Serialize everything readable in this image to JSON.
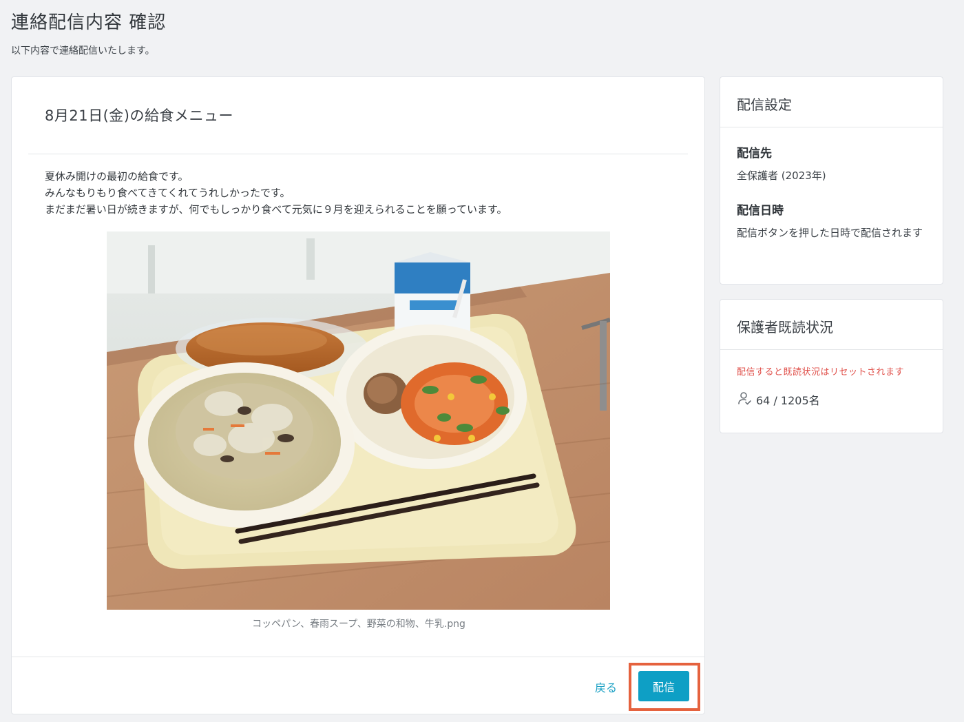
{
  "header": {
    "title": "連絡配信内容 確認",
    "subtitle": "以下内容で連絡配信いたします。"
  },
  "message": {
    "title": "8月21日(金)の給食メニュー",
    "body_lines": [
      "夏休み開けの最初の給食です。",
      "みんなもりもり食べてきてくれてうれしかったです。",
      "まだまだ暑い日が続きますが、何でもしっかり食べて元気に９月を迎えられることを願っています。"
    ],
    "image_caption": "コッペパン、春雨スープ、野菜の和物、牛乳.png"
  },
  "actions": {
    "back_label": "戻る",
    "send_label": "配信"
  },
  "delivery_settings": {
    "heading": "配信設定",
    "recipient_label": "配信先",
    "recipient_value": "全保護者 (2023年)",
    "datetime_label": "配信日時",
    "datetime_value": "配信ボタンを押した日時で配信されます"
  },
  "read_status": {
    "heading": "保護者既読状況",
    "warning": "配信すると既読状況はリセットされます",
    "count": "64 / 1205名",
    "icon": "user-check-icon"
  },
  "colors": {
    "accent": "#0e9fc5",
    "link": "#1aa0c4",
    "warning": "#e0514b",
    "highlight": "#e5623e"
  }
}
